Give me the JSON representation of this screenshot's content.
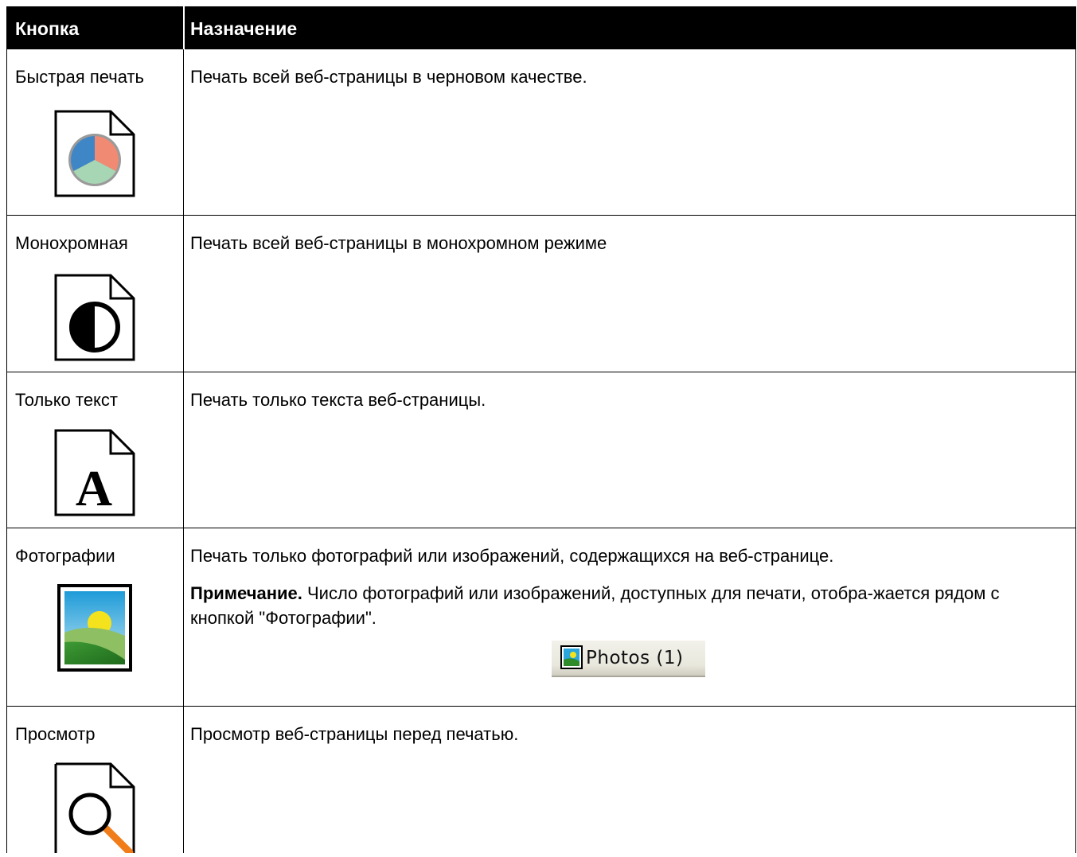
{
  "header": {
    "col_button": "Кнопка",
    "col_purpose": "Назначение"
  },
  "rows": [
    {
      "label": "Быстрая печать",
      "description": "Печать всей веб-страницы в черновом качестве.",
      "icon": "quick-print-icon"
    },
    {
      "label": "Монохромная",
      "description": "Печать всей веб-страницы в монохромном режиме",
      "icon": "monochrome-icon"
    },
    {
      "label": "Только текст",
      "description": "Печать только текста веб-страницы.",
      "icon": "text-only-icon"
    },
    {
      "label": "Фотографии",
      "description": "Печать только фотографий или изображений, содержащихся на веб-странице.",
      "icon": "photos-icon",
      "note_label": "Примечание.",
      "note_text": " Число фотографий или изображений, доступных для печати, отобра-жается рядом с кнопкой \"Фотографии\".",
      "button_label": "Photos (1)"
    },
    {
      "label": "Просмотр",
      "description": "Просмотр веб-страницы перед печатью.",
      "icon": "preview-icon"
    }
  ],
  "colors": {
    "header_bg": "#000000",
    "header_text": "#ffffff",
    "pie_blue": "#3f86c6",
    "pie_red": "#f08a73",
    "pie_green": "#a6d6b4",
    "magnifier_handle": "#f07d1a"
  }
}
